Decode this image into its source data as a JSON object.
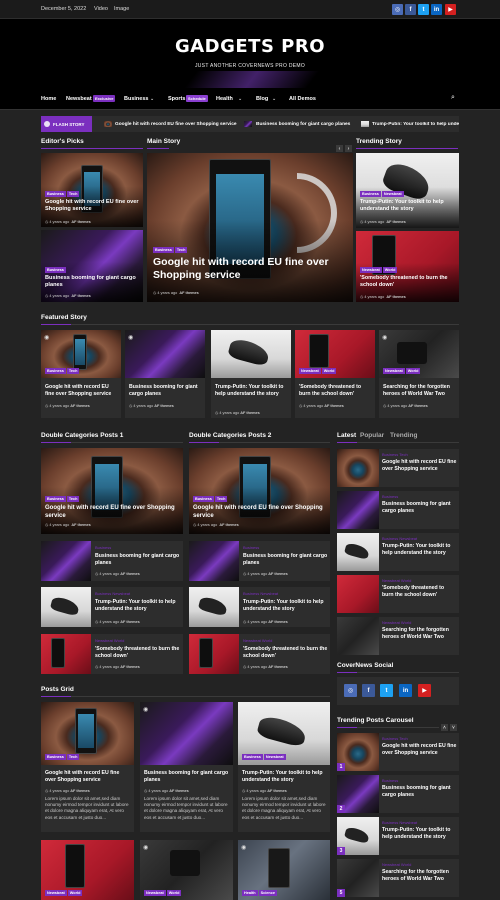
{
  "topbar": {
    "date": "December 5, 2022",
    "links": [
      "Video",
      "Image"
    ]
  },
  "social": {
    "icons": [
      "instagram-icon",
      "facebook-icon",
      "twitter-icon",
      "linkedin-icon",
      "youtube-icon"
    ],
    "glyphs": [
      "◎",
      "f",
      "t",
      "in",
      "▶"
    ]
  },
  "site": {
    "title": "GADGETS PRO",
    "tagline": "JUST ANOTHER COVERNEWS PRO DEMO"
  },
  "nav": {
    "items": [
      "Home",
      "Newsbeat",
      "Business",
      "Sports",
      "Health",
      "Blog",
      "All Demos"
    ],
    "newsbeat_badge": "Exclusive",
    "sports_badge": "Schedule",
    "colors": {
      "exclusive": "#7b2fbf",
      "schedule": "#8a3fd0"
    }
  },
  "flash": {
    "label": "FLASH STORY",
    "items": [
      "Google hit with record EU fine over Shopping service",
      "Business booming for giant cargo planes",
      "Trump-Putin: Your toolkit to help understand the story"
    ]
  },
  "sections": {
    "editors": "Editor's Picks",
    "main": "Main Story",
    "trending": "Trending Story",
    "featured": "Featured Story",
    "dbl1": "Double Categories Posts 1",
    "dbl2": "Double Categories Posts 2",
    "social": "CoverNews Social",
    "carousel": "Trending Posts Carousel",
    "grid": "Posts Grid"
  },
  "meta": {
    "age": "4 years ago",
    "author": "AF themes"
  },
  "posts": {
    "google": "Google hit with record EU fine over Shopping service",
    "cargo": "Business booming for giant cargo planes",
    "trump": "Trump-Putin: Your toolkit to help understand the story",
    "threat": "'Somebody threatened to burn the school down'",
    "heroes": "Searching for the forgotten heroes of World War Two"
  },
  "cats": {
    "business": "Business",
    "tech": "Tech",
    "newsbeat": "Newsbeat",
    "world": "World",
    "health": "Health",
    "science": "Science"
  },
  "tabs": [
    "Latest",
    "Popular",
    "Trending"
  ],
  "lorem": "Lorem ipsum dolor sit amet,sed diam nonumy eirmod tempor invidunt ut labore et dolore magna aliquyam erat, At vero eos et accusam et justo duo...",
  "carousel_nums": [
    "1",
    "2",
    "3",
    "4",
    "5"
  ],
  "accent": "#7b2fbf"
}
